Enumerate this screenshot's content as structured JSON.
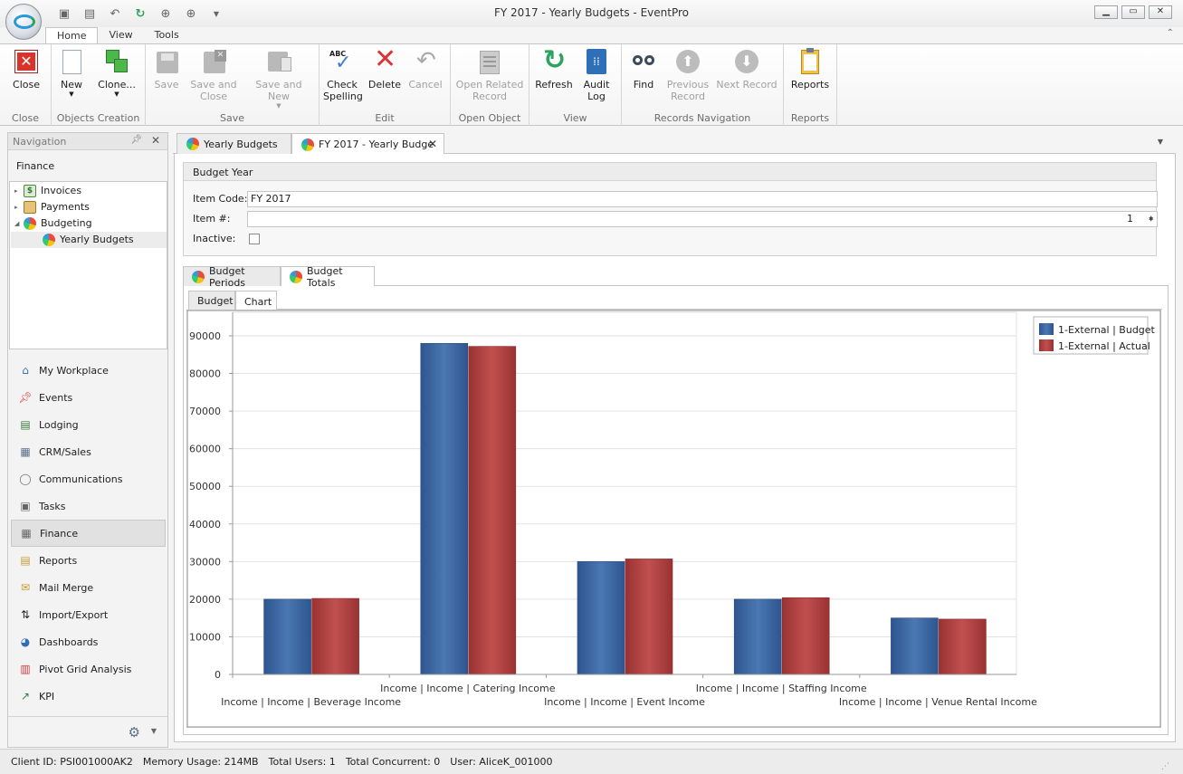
{
  "window": {
    "title": "FY 2017 - Yearly Budgets - EventPro"
  },
  "ribbon": {
    "tabs": [
      "Home",
      "View",
      "Tools"
    ],
    "active_tab": "Home",
    "groups": [
      {
        "label": "Close",
        "buttons": [
          {
            "label": "Close",
            "icon": "close-icon",
            "enabled": true
          }
        ]
      },
      {
        "label": "Objects Creation",
        "buttons": [
          {
            "label": "New",
            "icon": "new-document-icon",
            "enabled": true
          },
          {
            "label": "Clone...",
            "icon": "clone-icon",
            "enabled": true
          }
        ]
      },
      {
        "label": "Save",
        "buttons": [
          {
            "label": "Save",
            "icon": "save-icon",
            "enabled": false
          },
          {
            "label": "Save and Close",
            "line1": "Save and",
            "line2": "Close",
            "icon": "save-close-icon",
            "enabled": false
          },
          {
            "label": "Save and New",
            "icon": "save-new-icon",
            "enabled": false
          }
        ]
      },
      {
        "label": "Edit",
        "buttons": [
          {
            "label": "Check Spelling",
            "line1": "Check",
            "line2": "Spelling",
            "icon": "spellcheck-icon",
            "enabled": true
          },
          {
            "label": "Delete",
            "icon": "delete-icon",
            "enabled": true
          },
          {
            "label": "Cancel",
            "icon": "undo-icon",
            "enabled": false
          }
        ]
      },
      {
        "label": "Open Object",
        "buttons": [
          {
            "label": "Open Related Record",
            "line1": "Open Related",
            "line2": "Record",
            "icon": "open-record-icon",
            "enabled": false
          }
        ]
      },
      {
        "label": "View",
        "buttons": [
          {
            "label": "Refresh",
            "icon": "refresh-icon",
            "enabled": true
          },
          {
            "label": "Audit Log",
            "line1": "Audit",
            "line2": "Log",
            "icon": "audit-log-icon",
            "enabled": true
          }
        ]
      },
      {
        "label": "Records Navigation",
        "buttons": [
          {
            "label": "Find",
            "icon": "binoculars-icon",
            "enabled": true
          },
          {
            "label": "Previous Record",
            "line1": "Previous",
            "line2": "Record",
            "icon": "up-arrow-icon",
            "enabled": false
          },
          {
            "label": "Next Record",
            "icon": "down-arrow-icon",
            "enabled": false
          }
        ]
      },
      {
        "label": "Reports",
        "buttons": [
          {
            "label": "Reports",
            "icon": "reports-icon",
            "enabled": true
          }
        ]
      }
    ]
  },
  "navigation": {
    "title": "Navigation",
    "group_title": "Finance",
    "tree": [
      {
        "label": "Invoices",
        "icon": "invoice-icon",
        "arrow": "▸"
      },
      {
        "label": "Payments",
        "icon": "payments-icon",
        "arrow": "▸"
      },
      {
        "label": "Budgeting",
        "icon": "pie-chart-icon",
        "arrow": "◢"
      },
      {
        "label": "Yearly Budgets",
        "icon": "yearly-budget-icon",
        "arrow": ""
      }
    ],
    "items": [
      {
        "label": "My Workplace",
        "icon": "home-icon"
      },
      {
        "label": "Events",
        "icon": "pushpin-icon"
      },
      {
        "label": "Lodging",
        "icon": "lodging-icon"
      },
      {
        "label": "CRM/Sales",
        "icon": "crm-icon"
      },
      {
        "label": "Communications",
        "icon": "speech-bubble-icon"
      },
      {
        "label": "Tasks",
        "icon": "tasks-icon"
      },
      {
        "label": "Finance",
        "icon": "calculator-icon",
        "active": true
      },
      {
        "label": "Reports",
        "icon": "clipboard-icon"
      },
      {
        "label": "Mail Merge",
        "icon": "mail-merge-icon"
      },
      {
        "label": "Import/Export",
        "icon": "import-export-icon"
      },
      {
        "label": "Dashboards",
        "icon": "dashboard-icon"
      },
      {
        "label": "Pivot Grid Analysis",
        "icon": "pivot-grid-icon"
      },
      {
        "label": "KPI",
        "icon": "kpi-icon"
      }
    ]
  },
  "doc_tabs": [
    {
      "label": "Yearly Budgets",
      "active": false
    },
    {
      "label": "FY 2017 - Yearly Budge",
      "active": true
    }
  ],
  "form": {
    "group_title": "Budget Year",
    "item_code_label": "Item Code:",
    "item_code_value": "FY 2017",
    "item_number_label": "Item #:",
    "item_number_value": "1",
    "inactive_label": "Inactive:",
    "inactive_checked": false
  },
  "tabs": {
    "outer": [
      "Budget Periods",
      "Budget Totals"
    ],
    "outer_active": "Budget Totals",
    "inner": [
      "Budget",
      "Chart"
    ],
    "inner_active": "Chart"
  },
  "chart_data": {
    "type": "bar",
    "categories": [
      "Income | Income | Beverage Income",
      "Income | Income | Catering Income",
      "Income | Income | Event Income",
      "Income | Income | Staffing Income",
      "Income | Income | Venue Rental Income"
    ],
    "series": [
      {
        "name": "1-External | Budget",
        "color": "#3c66a0",
        "values": [
          20000,
          88000,
          30000,
          20000,
          15000
        ]
      },
      {
        "name": "1-External | Actual",
        "color": "#b04040",
        "values": [
          20200,
          87200,
          30700,
          20400,
          14700
        ]
      }
    ],
    "yticks": [
      0,
      10000,
      20000,
      30000,
      40000,
      50000,
      60000,
      70000,
      80000,
      90000
    ],
    "ylim": [
      0,
      90000
    ],
    "grid": true,
    "legend_position": "top-right"
  },
  "status": {
    "client_id": "Client ID: PSI001000AK2",
    "memory": "Memory Usage: 214MB",
    "total_users": "Total Users: 1",
    "total_concurrent": "Total Concurrent: 0",
    "user": "User: AliceK_001000"
  }
}
